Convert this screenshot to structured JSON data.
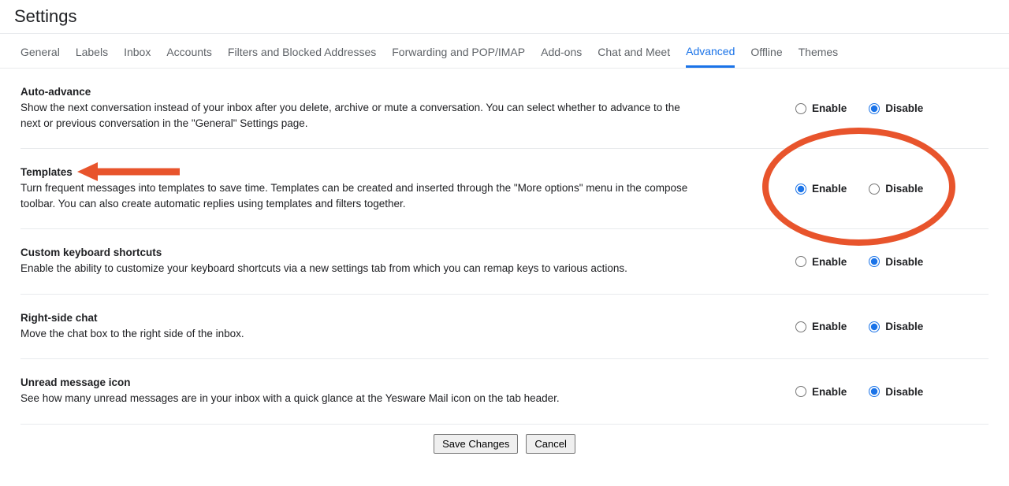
{
  "header": {
    "title": "Settings"
  },
  "tabs": [
    {
      "label": "General"
    },
    {
      "label": "Labels"
    },
    {
      "label": "Inbox"
    },
    {
      "label": "Accounts"
    },
    {
      "label": "Filters and Blocked Addresses"
    },
    {
      "label": "Forwarding and POP/IMAP"
    },
    {
      "label": "Add-ons"
    },
    {
      "label": "Chat and Meet"
    },
    {
      "label": "Advanced",
      "active": true
    },
    {
      "label": "Offline"
    },
    {
      "label": "Themes"
    }
  ],
  "radio_labels": {
    "enable": "Enable",
    "disable": "Disable"
  },
  "settings": [
    {
      "title": "Auto-advance",
      "desc": "Show the next conversation instead of your inbox after you delete, archive or mute a conversation. You can select whether to advance to the next or previous conversation in the \"General\" Settings page.",
      "value": "disable"
    },
    {
      "title": "Templates",
      "desc": "Turn frequent messages into templates to save time. Templates can be created and inserted through the \"More options\" menu in the compose toolbar. You can also create automatic replies using templates and filters together.",
      "value": "enable",
      "highlight": true
    },
    {
      "title": "Custom keyboard shortcuts",
      "desc": "Enable the ability to customize your keyboard shortcuts via a new settings tab from which you can remap keys to various actions.",
      "value": "disable"
    },
    {
      "title": "Right-side chat",
      "desc": "Move the chat box to the right side of the inbox.",
      "value": "disable"
    },
    {
      "title": "Unread message icon",
      "desc": "See how many unread messages are in your inbox with a quick glance at the Yesware Mail icon on the tab header.",
      "value": "disable"
    }
  ],
  "buttons": {
    "save": "Save Changes",
    "cancel": "Cancel"
  }
}
